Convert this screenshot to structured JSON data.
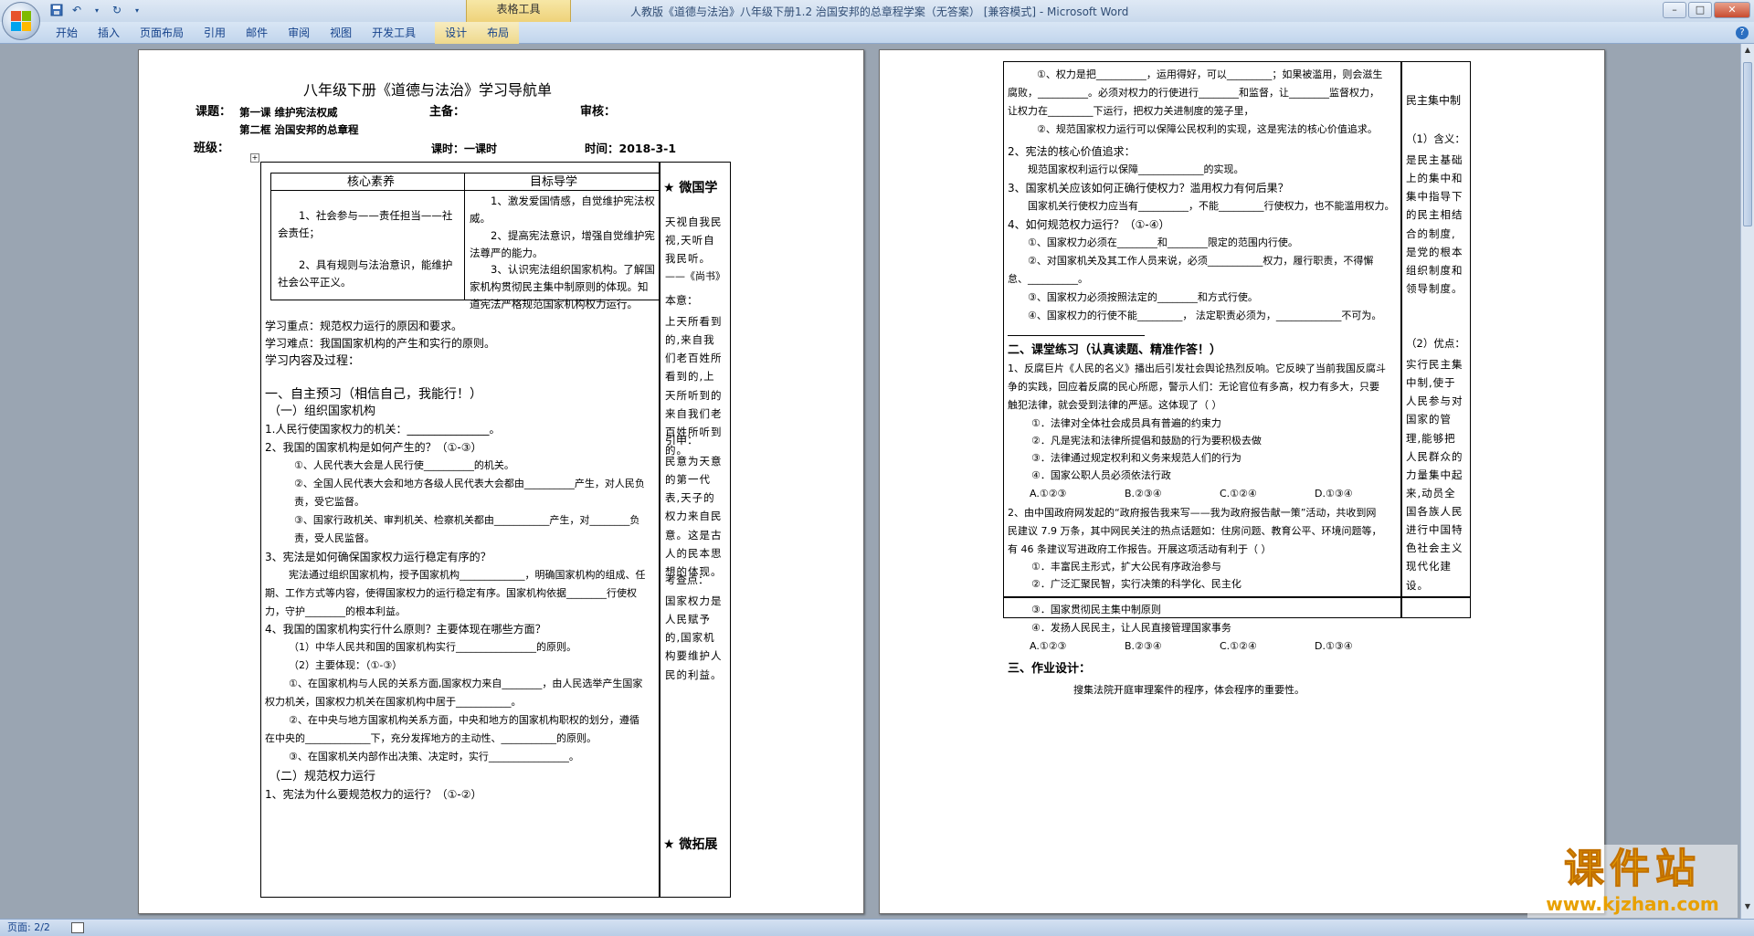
{
  "window": {
    "title": "人教版《道德与法治》八年级下册1.2  治国安邦的总章程学案（无答案） [兼容模式] - Microsoft Word",
    "context_tab": "表格工具"
  },
  "ribbon": {
    "tabs": [
      "开始",
      "插入",
      "页面布局",
      "引用",
      "邮件",
      "审阅",
      "视图",
      "开发工具",
      "设计",
      "布局"
    ]
  },
  "status": {
    "page": "页面: 2/2"
  },
  "watermark": {
    "main": "课件站",
    "url": "www.kjzhan.com"
  },
  "page1": {
    "title": "八年级下册《道德与法治》学习导航单",
    "course_label": "课题：",
    "lesson1": "第一课  维护宪法权威",
    "lesson2": "第二框  治国安邦的总章程",
    "editor": "主备：",
    "reviewer": "审核：",
    "class": "班级：",
    "hours": "课时：一课时",
    "date": "时间：2018-3-1",
    "core_header": "核心素养",
    "goal_header": "目标导学",
    "core_1": "1、社会参与——责任担当——社会责任；",
    "core_2": "2、具有规则与法治意识，能维护社会公平正义。",
    "goal_1": "1、激发爱国情感，自觉维护宪法权威。",
    "goal_2": "2、提高宪法意识，增强自觉维护宪法尊严的能力。",
    "goal_3": "3、认识宪法组织国家机构。了解国家机构贯彻民主集中制原则的体现。知道宪法严格规范国家机构权力运行。",
    "key": "学习重点：规范权力运行的原因和要求。",
    "difficulty": "学习难点：我国国家机构的产生和实行的原则。",
    "process": "学习内容及过程：",
    "sec1": "一、自主预习（相信自己，我能行！）",
    "sub1": "（一）组织国家机构",
    "q1": "1.人民行使国家权力的机关：_______________。",
    "q2": "2、我国的国家机构是如何产生的？（①-③）",
    "q2a": "①、人民代表大会是人民行使__________的机关。",
    "q2b": "②、全国人民代表大会和地方各级人民代表大会都由__________产生，对人民负",
    "q2b2": "责，受它监督。",
    "q2c": "③、国家行政机关、审判机关、检察机关都由___________产生，对________负",
    "q2c2": "责，受人民监督。",
    "q3": "3、宪法是如何确保国家权力运行稳定有序的？",
    "q3a": "宪法通过组织国家机构，授予国家机构_____________，明确国家机构的组成、任",
    "q3b": "期、工作方式等内容，使得国家权力的运行稳定有序。国家机构依据________行使权",
    "q3c": "力，守护________的根本利益。",
    "q4": "4、我国的国家机构实行什么原则？主要体现在哪些方面？",
    "q4a": "（1）中华人民共和国的国家机构实行________________的原则。",
    "q4b": "（2）主要体现：（①-③）",
    "q4c": "①、在国家机构与人民的关系方面,国家权力来自________，由人民选举产生国家",
    "q4c2": "权力机关，国家权力机关在国家机构中居于___________。",
    "q4d": "②、在中央与地方国家机构关系方面，中央和地方的国家机构职权的划分，遵循",
    "q4d2": "在中央的_____________下，充分发挥地方的主动性、___________的原则。",
    "q4e": "③、在国家机关内部作出决策、决定时，实行________________。",
    "sub2": "（二）规范权力运行",
    "q5": "1、宪法为什么要规范权力的运行？（①-②）",
    "side_title": "★ 微国学",
    "side_text1": "天视自我民视,天听自我民听。",
    "side_src": "——《尚书》",
    "side_meaning_label": "本意：",
    "side_meaning": "上天所看到的,来自我们老百姓所看到的,上天所听到的来自我们老百姓所听到的。",
    "side_ext_label": "引申：",
    "side_ext": "民意为天意的第一代表,天子的权力来自民意。这是古人的民本思想的体现。",
    "side_exam_label": "考查点：",
    "side_exam": "国家权力是人民赋予的,国家机构要维护人民的利益。",
    "side_ext_title": "★ 微拓展"
  },
  "page2": {
    "p1a": "①、权力是把__________，运用得好，可以_________；如果被滥用，则会滋生",
    "p1b": "腐败，__________。必须对权力的行使进行________和监督，让________监督权力，",
    "p1c": "让权力在_________下运行，把权力关进制度的笼子里，",
    "p1d": "②、规范国家权力运行可以保障公民权利的实现，这是宪法的核心价值追求。",
    "q2": "2、宪法的核心价值追求：",
    "q2a": "规范国家权利运行以保障_____________的实现。",
    "q3": "3、国家机关应该如何正确行使权力？滥用权力有何后果？",
    "q3a": "国家机关行使权力应当有__________，不能_________行使权力，也不能滥用权力。",
    "q4": "4、如何规范权力运行？（①-④）",
    "q4a": "①、国家权力必须在________和________限定的范围内行使。",
    "q4b": "②、对国家机关及其工作人员来说，必须___________权力，履行职责，不得懈",
    "q4b2": "怠、__________。",
    "q4c": "③、国家权力必须按照法定的________和方式行使。",
    "q4d": "④、国家权力的行使不能_________，  法定职责必须为，_____________不可为。",
    "sec2": "二、课堂练习（认真读题、精准作答！）",
    "e1a": "1、反腐巨片《人民的名义》播出后引发社会舆论热烈反响。它反映了当前我国反腐斗",
    "e1b": "争的实践，回应着反腐的民心所愿，警示人们：无论官位有多高，权力有多大，只要",
    "e1c": "触犯法律，就会受到法律的严惩。这体现了（        ）",
    "e1o1": "①．法律对全体社会成员具有普遍的约束力",
    "e1o2": "②．凡是宪法和法律所提倡和鼓励的行为要积极去做",
    "e1o3": "③．法律通过规定权利和义务来规范人们的行为",
    "e1o4": "④．国家公职人员必须依法行政",
    "e1c1": "A.①②③",
    "e1c2": "B.②③④",
    "e1c3": "C.①②④",
    "e1c4": "D.①③④",
    "e2a": "2、由中国政府网发起的“政府报告我来写——我为政府报告献一策”活动，共收到网",
    "e2b": "民建议 7.9 万条，其中网民关注的热点话题如：住房问题、教育公平、环境问题等，",
    "e2c": "有 46 条建议写进政府工作报告。开展这项活动有利于（       ）",
    "e2o1": "①．丰富民主形式，扩大公民有序政治参与",
    "e2o2": "②．广泛汇聚民智，实行决策的科学化、民主化",
    "e2o3": "③．国家贯彻民主集中制原则",
    "e2o4": "④．发扬人民民主，让人民直接管理国家事务",
    "e2c1": "A.①②③",
    "e2c2": "B.②③④",
    "e2c3": "C.①②④",
    "e2c4": "D.①③④",
    "sec3": "三、作业设计：",
    "hw": "搜集法院开庭审理案件的程序，体会程序的重要性。",
    "side_head": "民主集中制",
    "side_def_label": "（1）含义：",
    "side_def": "是民主基础上的集中和集中指导下的民主相结合的制度,是党的根本组织制度和领导制度。",
    "side_adv_label": "（2）优点：",
    "side_adv": "实行民主集中制,使于人民参与对国家的管理,能够把人民群众的力量集中起来,动员全国各族人民进行中国特色社会主义现代化建设。"
  }
}
